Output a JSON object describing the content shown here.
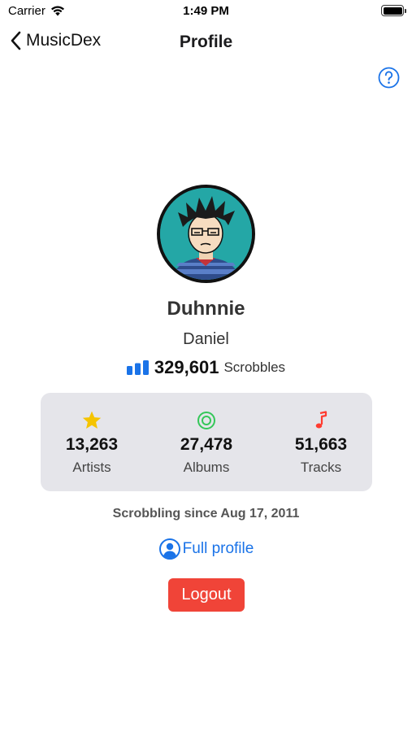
{
  "status_bar": {
    "carrier": "Carrier",
    "time": "1:49 PM"
  },
  "nav": {
    "back_label": "MusicDex",
    "title": "Profile"
  },
  "help": {
    "icon": "question-circle-icon"
  },
  "profile": {
    "username": "Duhnnie",
    "real_name": "Daniel",
    "scrobbles_count": "329,601",
    "scrobbles_label": "Scrobbles",
    "scrobbling_since": "Scrobbling since Aug 17, 2011"
  },
  "stats": [
    {
      "icon": "star-icon",
      "value": "13,263",
      "label": "Artists",
      "color": "#f5c400"
    },
    {
      "icon": "record-icon",
      "value": "27,478",
      "label": "Albums",
      "color": "#34c759"
    },
    {
      "icon": "music-note-icon",
      "value": "51,663",
      "label": "Tracks",
      "color": "#ff3b30"
    }
  ],
  "actions": {
    "full_profile_label": "Full profile",
    "logout_label": "Logout"
  },
  "colors": {
    "accent": "#1a73e8",
    "logout": "#f04438",
    "card_bg": "#e5e5ea",
    "avatar_bg": "#24a7a6"
  }
}
